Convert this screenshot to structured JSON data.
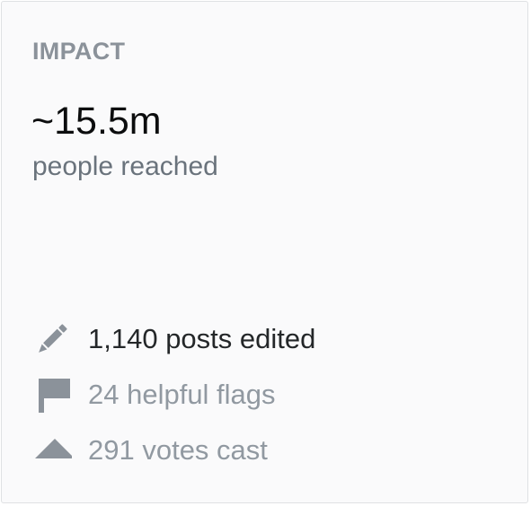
{
  "impact": {
    "heading": "IMPACT",
    "reach_value": "~15.5m",
    "reach_label": "people reached"
  },
  "stats": [
    {
      "icon": "pencil-icon",
      "text": "1,140 posts edited"
    },
    {
      "icon": "flag-icon",
      "text": "24 helpful flags"
    },
    {
      "icon": "upvote-arrow-icon",
      "text": "291 votes cast"
    }
  ],
  "colors": {
    "card_background": "#fafafb",
    "card_border": "#dfe1e3",
    "heading": "#8b929a",
    "reach_value": "#0c0d0e",
    "muted_text": "#6a737c",
    "icon": "#8b929a"
  }
}
